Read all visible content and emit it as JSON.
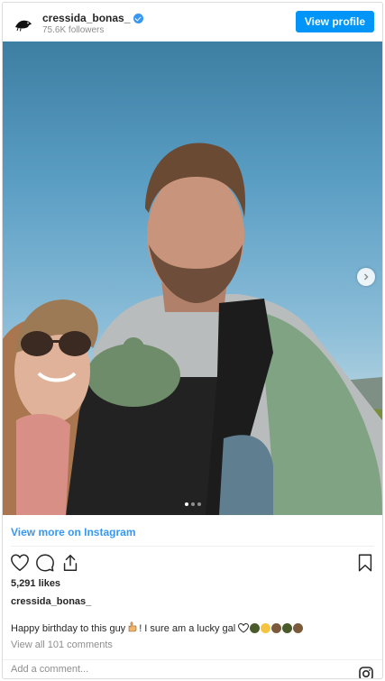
{
  "header": {
    "username": "cressida_bonas_",
    "followers": "75.6K followers",
    "view_profile_label": "View profile"
  },
  "photo": {
    "alt": "Selfie on a hillside with a baby in a carrier",
    "carousel_dots": 3,
    "active_dot": 0
  },
  "view_more_label": "View more on Instagram",
  "likes": "5,291 likes",
  "caption": {
    "username": "cressida_bonas_",
    "text_before_emoji": "Happy birthday to this guy",
    "text_after_emoji": "! I sure am a lucky gal",
    "emoji_names": [
      "pointing-hand",
      "heart-outline",
      "sunglasses-face",
      "star-struck-face",
      "grinning-face",
      "sunglasses-face",
      "grinning-face"
    ]
  },
  "view_comments": "View all 101 comments",
  "add_comment_placeholder": "Add a comment...",
  "colors": {
    "accent": "#0095f6",
    "link": "#3897f0",
    "muted": "#8e8e8e"
  }
}
